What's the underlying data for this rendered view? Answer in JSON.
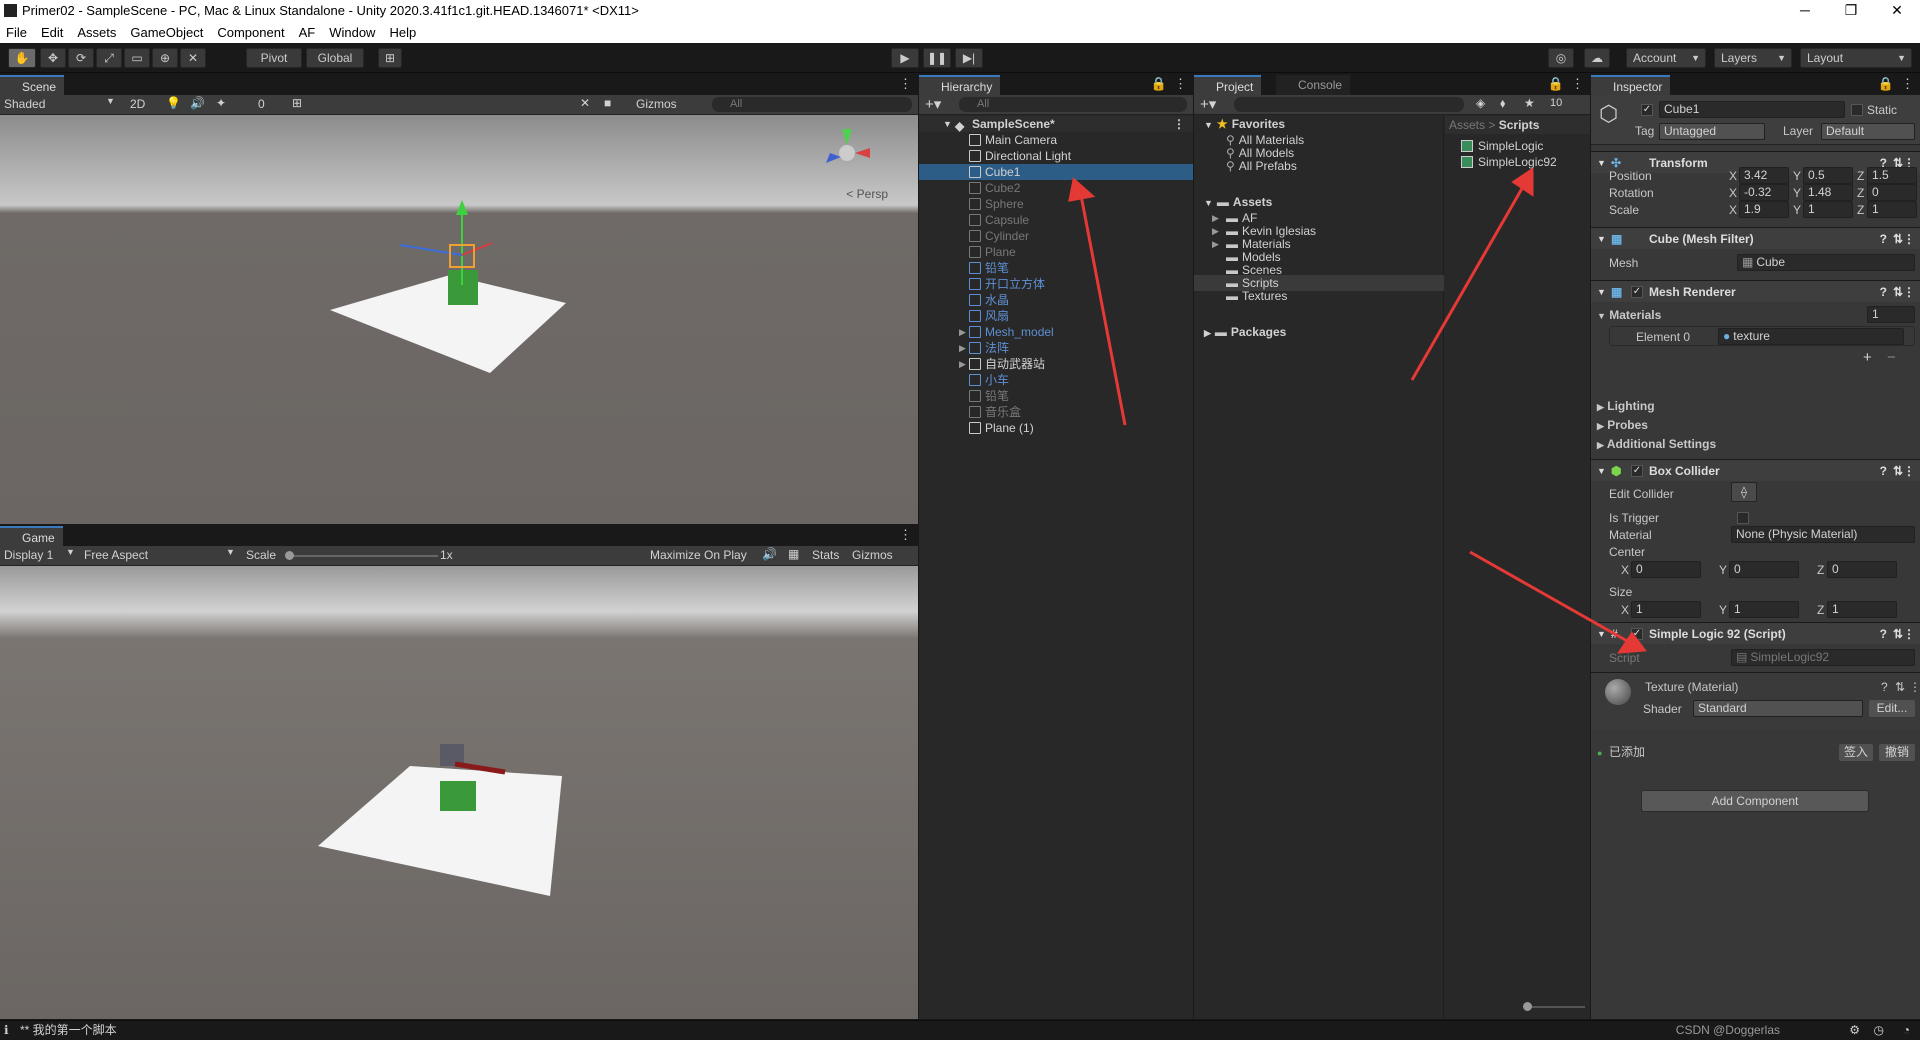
{
  "window": {
    "title": "Primer02 - SampleScene - PC, Mac & Linux Standalone - Unity 2020.3.41f1c1.git.HEAD.1346071* <DX11>",
    "buttons": [
      "─",
      "❐",
      "✕"
    ]
  },
  "menu": [
    "File",
    "Edit",
    "Assets",
    "GameObject",
    "Component",
    "AF",
    "Window",
    "Help"
  ],
  "toolbar": {
    "pivot": "Pivot",
    "global": "Global",
    "account": "Account",
    "layers": "Layers",
    "layout": "Layout",
    "collab_count": "10"
  },
  "scene": {
    "tab": "Scene",
    "shading": "Shaded",
    "mode2d": "2D",
    "hidden_count": "0",
    "gizmos": "Gizmos",
    "search": "All",
    "persp": "< Persp"
  },
  "game": {
    "tab": "Game",
    "display": "Display 1",
    "aspect": "Free Aspect",
    "scale_label": "Scale",
    "scale_value": "1x",
    "maximize": "Maximize On Play",
    "stats": "Stats",
    "gizmos": "Gizmos"
  },
  "hierarchy": {
    "tab": "Hierarchy",
    "search": "All",
    "scene": "SampleScene*",
    "items": [
      {
        "name": "Main Camera",
        "style": "normal",
        "depth": 1,
        "expand": false
      },
      {
        "name": "Directional Light",
        "style": "normal",
        "depth": 1,
        "expand": false
      },
      {
        "name": "Cube1",
        "style": "selected",
        "depth": 1,
        "expand": false
      },
      {
        "name": "Cube2",
        "style": "dim",
        "depth": 1,
        "expand": false
      },
      {
        "name": "Sphere",
        "style": "dim",
        "depth": 1,
        "expand": false
      },
      {
        "name": "Capsule",
        "style": "dim",
        "depth": 1,
        "expand": false
      },
      {
        "name": "Cylinder",
        "style": "dim",
        "depth": 1,
        "expand": false
      },
      {
        "name": "Plane",
        "style": "dim",
        "depth": 1,
        "expand": false
      },
      {
        "name": "铅笔",
        "style": "blue",
        "depth": 1,
        "expand": false
      },
      {
        "name": "开口立方体",
        "style": "blue",
        "depth": 1,
        "expand": false
      },
      {
        "name": "水晶",
        "style": "blue",
        "depth": 1,
        "expand": false
      },
      {
        "name": "风扇",
        "style": "blue",
        "depth": 1,
        "expand": false
      },
      {
        "name": "Mesh_model",
        "style": "blue",
        "depth": 1,
        "expand": true
      },
      {
        "name": "法阵",
        "style": "blue",
        "depth": 1,
        "expand": true
      },
      {
        "name": "自动武器站",
        "style": "normal",
        "depth": 1,
        "expand": true
      },
      {
        "name": "小车",
        "style": "blue",
        "depth": 1,
        "expand": false
      },
      {
        "name": "铅笔",
        "style": "dim",
        "depth": 1,
        "expand": false
      },
      {
        "name": "音乐盒",
        "style": "dim",
        "depth": 1,
        "expand": false
      },
      {
        "name": "Plane (1)",
        "style": "normal",
        "depth": 1,
        "expand": false
      }
    ]
  },
  "project": {
    "tab_project": "Project",
    "tab_console": "Console",
    "favorites_label": "Favorites",
    "favorites": [
      "All Materials",
      "All Models",
      "All Prefabs"
    ],
    "assets_label": "Assets",
    "assets": [
      {
        "name": "AF",
        "expand": true
      },
      {
        "name": "Kevin Iglesias",
        "expand": true
      },
      {
        "name": "Materials",
        "expand": true
      },
      {
        "name": "Models",
        "expand": false
      },
      {
        "name": "Scenes",
        "expand": false
      },
      {
        "name": "Scripts",
        "expand": false
      },
      {
        "name": "Textures",
        "expand": false
      }
    ],
    "packages_label": "Packages",
    "breadcrumb_root": "Assets",
    "breadcrumb_sep": ">",
    "breadcrumb_current": "Scripts",
    "files": [
      "SimpleLogic",
      "SimpleLogic92"
    ]
  },
  "inspector": {
    "tab": "Inspector",
    "object_name": "Cube1",
    "static_label": "Static",
    "tag_label": "Tag",
    "tag_value": "Untagged",
    "layer_label": "Layer",
    "layer_value": "Default",
    "transform": {
      "title": "Transform",
      "position_label": "Position",
      "rotation_label": "Rotation",
      "scale_label": "Scale",
      "position": {
        "x": "3.42",
        "y": "0.5",
        "z": "1.5"
      },
      "rotation": {
        "x": "-0.32",
        "y": "1.48",
        "z": "0"
      },
      "scale": {
        "x": "1.9",
        "y": "1",
        "z": "1"
      }
    },
    "mesh_filter": {
      "title": "Cube (Mesh Filter)",
      "mesh_label": "Mesh",
      "mesh_value": "Cube"
    },
    "mesh_renderer": {
      "title": "Mesh Renderer",
      "materials_label": "Materials",
      "materials_count": "1",
      "element_label": "Element 0",
      "element_value": "texture",
      "lighting": "Lighting",
      "probes": "Probes",
      "additional": "Additional Settings"
    },
    "box_collider": {
      "title": "Box Collider",
      "edit_collider": "Edit Collider",
      "is_trigger": "Is Trigger",
      "material_label": "Material",
      "material_value": "None (Physic Material)",
      "center_label": "Center",
      "center": {
        "x": "0",
        "y": "0",
        "z": "0"
      },
      "size_label": "Size",
      "size": {
        "x": "1",
        "y": "1",
        "z": "1"
      }
    },
    "script_comp": {
      "title": "Simple Logic 92 (Script)",
      "script_label": "Script",
      "script_value": "SimpleLogic92"
    },
    "material": {
      "title": "Texture (Material)",
      "shader_label": "Shader",
      "shader_value": "Standard",
      "edit": "Edit...",
      "added": "已添加",
      "checkin": "签入",
      "undo": "撤销"
    },
    "add_component": "Add Component"
  },
  "axis_labels": {
    "x": "X",
    "y": "Y",
    "z": "Z"
  },
  "status": {
    "message": "** 我的第一个脚本",
    "watermark": "CSDN @Doggerlas"
  }
}
